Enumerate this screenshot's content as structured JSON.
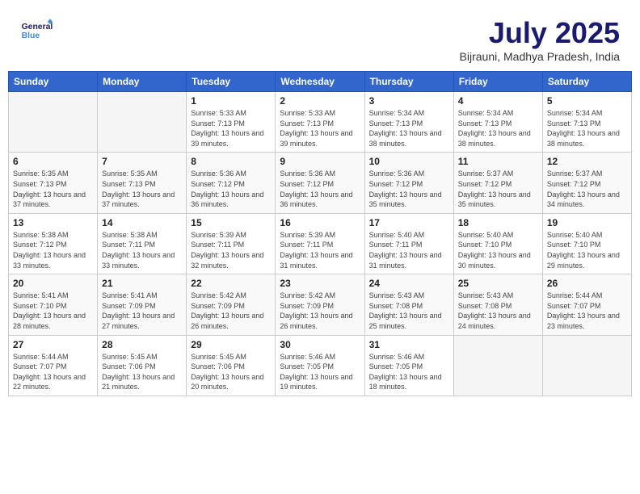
{
  "header": {
    "logo_general": "General",
    "logo_blue": "Blue",
    "month_title": "July 2025",
    "location": "Bijrauni, Madhya Pradesh, India"
  },
  "weekdays": [
    "Sunday",
    "Monday",
    "Tuesday",
    "Wednesday",
    "Thursday",
    "Friday",
    "Saturday"
  ],
  "weeks": [
    [
      {
        "day": "",
        "sunrise": "",
        "sunset": "",
        "daylight": ""
      },
      {
        "day": "",
        "sunrise": "",
        "sunset": "",
        "daylight": ""
      },
      {
        "day": "1",
        "sunrise": "Sunrise: 5:33 AM",
        "sunset": "Sunset: 7:13 PM",
        "daylight": "Daylight: 13 hours and 39 minutes."
      },
      {
        "day": "2",
        "sunrise": "Sunrise: 5:33 AM",
        "sunset": "Sunset: 7:13 PM",
        "daylight": "Daylight: 13 hours and 39 minutes."
      },
      {
        "day": "3",
        "sunrise": "Sunrise: 5:34 AM",
        "sunset": "Sunset: 7:13 PM",
        "daylight": "Daylight: 13 hours and 38 minutes."
      },
      {
        "day": "4",
        "sunrise": "Sunrise: 5:34 AM",
        "sunset": "Sunset: 7:13 PM",
        "daylight": "Daylight: 13 hours and 38 minutes."
      },
      {
        "day": "5",
        "sunrise": "Sunrise: 5:34 AM",
        "sunset": "Sunset: 7:13 PM",
        "daylight": "Daylight: 13 hours and 38 minutes."
      }
    ],
    [
      {
        "day": "6",
        "sunrise": "Sunrise: 5:35 AM",
        "sunset": "Sunset: 7:13 PM",
        "daylight": "Daylight: 13 hours and 37 minutes."
      },
      {
        "day": "7",
        "sunrise": "Sunrise: 5:35 AM",
        "sunset": "Sunset: 7:13 PM",
        "daylight": "Daylight: 13 hours and 37 minutes."
      },
      {
        "day": "8",
        "sunrise": "Sunrise: 5:36 AM",
        "sunset": "Sunset: 7:12 PM",
        "daylight": "Daylight: 13 hours and 36 minutes."
      },
      {
        "day": "9",
        "sunrise": "Sunrise: 5:36 AM",
        "sunset": "Sunset: 7:12 PM",
        "daylight": "Daylight: 13 hours and 36 minutes."
      },
      {
        "day": "10",
        "sunrise": "Sunrise: 5:36 AM",
        "sunset": "Sunset: 7:12 PM",
        "daylight": "Daylight: 13 hours and 35 minutes."
      },
      {
        "day": "11",
        "sunrise": "Sunrise: 5:37 AM",
        "sunset": "Sunset: 7:12 PM",
        "daylight": "Daylight: 13 hours and 35 minutes."
      },
      {
        "day": "12",
        "sunrise": "Sunrise: 5:37 AM",
        "sunset": "Sunset: 7:12 PM",
        "daylight": "Daylight: 13 hours and 34 minutes."
      }
    ],
    [
      {
        "day": "13",
        "sunrise": "Sunrise: 5:38 AM",
        "sunset": "Sunset: 7:12 PM",
        "daylight": "Daylight: 13 hours and 33 minutes."
      },
      {
        "day": "14",
        "sunrise": "Sunrise: 5:38 AM",
        "sunset": "Sunset: 7:11 PM",
        "daylight": "Daylight: 13 hours and 33 minutes."
      },
      {
        "day": "15",
        "sunrise": "Sunrise: 5:39 AM",
        "sunset": "Sunset: 7:11 PM",
        "daylight": "Daylight: 13 hours and 32 minutes."
      },
      {
        "day": "16",
        "sunrise": "Sunrise: 5:39 AM",
        "sunset": "Sunset: 7:11 PM",
        "daylight": "Daylight: 13 hours and 31 minutes."
      },
      {
        "day": "17",
        "sunrise": "Sunrise: 5:40 AM",
        "sunset": "Sunset: 7:11 PM",
        "daylight": "Daylight: 13 hours and 31 minutes."
      },
      {
        "day": "18",
        "sunrise": "Sunrise: 5:40 AM",
        "sunset": "Sunset: 7:10 PM",
        "daylight": "Daylight: 13 hours and 30 minutes."
      },
      {
        "day": "19",
        "sunrise": "Sunrise: 5:40 AM",
        "sunset": "Sunset: 7:10 PM",
        "daylight": "Daylight: 13 hours and 29 minutes."
      }
    ],
    [
      {
        "day": "20",
        "sunrise": "Sunrise: 5:41 AM",
        "sunset": "Sunset: 7:10 PM",
        "daylight": "Daylight: 13 hours and 28 minutes."
      },
      {
        "day": "21",
        "sunrise": "Sunrise: 5:41 AM",
        "sunset": "Sunset: 7:09 PM",
        "daylight": "Daylight: 13 hours and 27 minutes."
      },
      {
        "day": "22",
        "sunrise": "Sunrise: 5:42 AM",
        "sunset": "Sunset: 7:09 PM",
        "daylight": "Daylight: 13 hours and 26 minutes."
      },
      {
        "day": "23",
        "sunrise": "Sunrise: 5:42 AM",
        "sunset": "Sunset: 7:09 PM",
        "daylight": "Daylight: 13 hours and 26 minutes."
      },
      {
        "day": "24",
        "sunrise": "Sunrise: 5:43 AM",
        "sunset": "Sunset: 7:08 PM",
        "daylight": "Daylight: 13 hours and 25 minutes."
      },
      {
        "day": "25",
        "sunrise": "Sunrise: 5:43 AM",
        "sunset": "Sunset: 7:08 PM",
        "daylight": "Daylight: 13 hours and 24 minutes."
      },
      {
        "day": "26",
        "sunrise": "Sunrise: 5:44 AM",
        "sunset": "Sunset: 7:07 PM",
        "daylight": "Daylight: 13 hours and 23 minutes."
      }
    ],
    [
      {
        "day": "27",
        "sunrise": "Sunrise: 5:44 AM",
        "sunset": "Sunset: 7:07 PM",
        "daylight": "Daylight: 13 hours and 22 minutes."
      },
      {
        "day": "28",
        "sunrise": "Sunrise: 5:45 AM",
        "sunset": "Sunset: 7:06 PM",
        "daylight": "Daylight: 13 hours and 21 minutes."
      },
      {
        "day": "29",
        "sunrise": "Sunrise: 5:45 AM",
        "sunset": "Sunset: 7:06 PM",
        "daylight": "Daylight: 13 hours and 20 minutes."
      },
      {
        "day": "30",
        "sunrise": "Sunrise: 5:46 AM",
        "sunset": "Sunset: 7:05 PM",
        "daylight": "Daylight: 13 hours and 19 minutes."
      },
      {
        "day": "31",
        "sunrise": "Sunrise: 5:46 AM",
        "sunset": "Sunset: 7:05 PM",
        "daylight": "Daylight: 13 hours and 18 minutes."
      },
      {
        "day": "",
        "sunrise": "",
        "sunset": "",
        "daylight": ""
      },
      {
        "day": "",
        "sunrise": "",
        "sunset": "",
        "daylight": ""
      }
    ]
  ]
}
